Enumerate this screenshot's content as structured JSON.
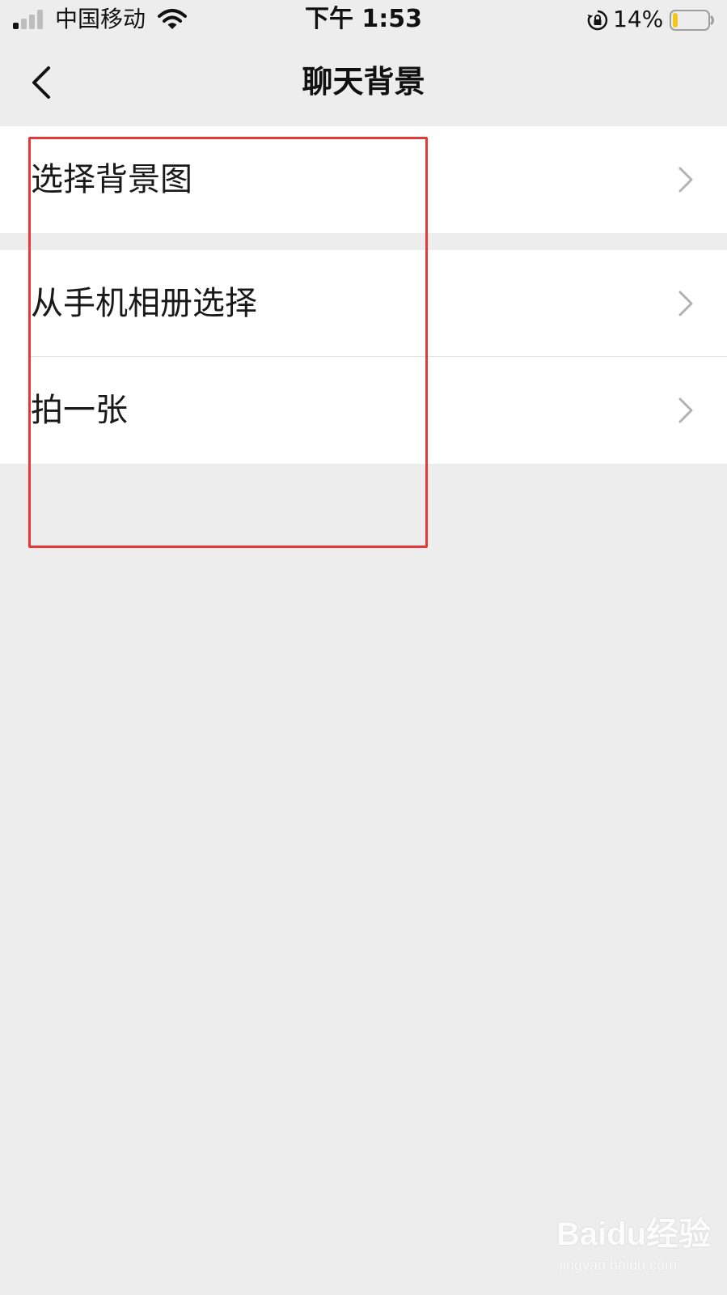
{
  "status_bar": {
    "carrier": "中国移动",
    "time": "下午 1:53",
    "battery_percent": "14%",
    "battery_level": 0.14,
    "signal_icon": "signal-icon",
    "wifi_icon": "wifi-icon",
    "lock_icon": "orientation-lock-icon",
    "battery_icon": "battery-icon"
  },
  "nav": {
    "title": "聊天背景",
    "back_icon": "chevron-left-icon"
  },
  "groups": [
    {
      "items": [
        {
          "label": "选择背景图",
          "icon": "chevron-right-icon"
        }
      ]
    },
    {
      "items": [
        {
          "label": "从手机相册选择",
          "icon": "chevron-right-icon"
        },
        {
          "label": "拍一张",
          "icon": "chevron-right-icon"
        }
      ]
    }
  ],
  "annotation": {
    "color": "#E53935"
  },
  "watermark": {
    "main": "Baidu经验",
    "sub": "jingyan.baidu.com"
  },
  "colors": {
    "background": "#EDEDED",
    "cell_background": "#FFFFFF",
    "text": "#191919",
    "chevron": "#B2B2B2",
    "battery_fill": "#F5C518"
  }
}
